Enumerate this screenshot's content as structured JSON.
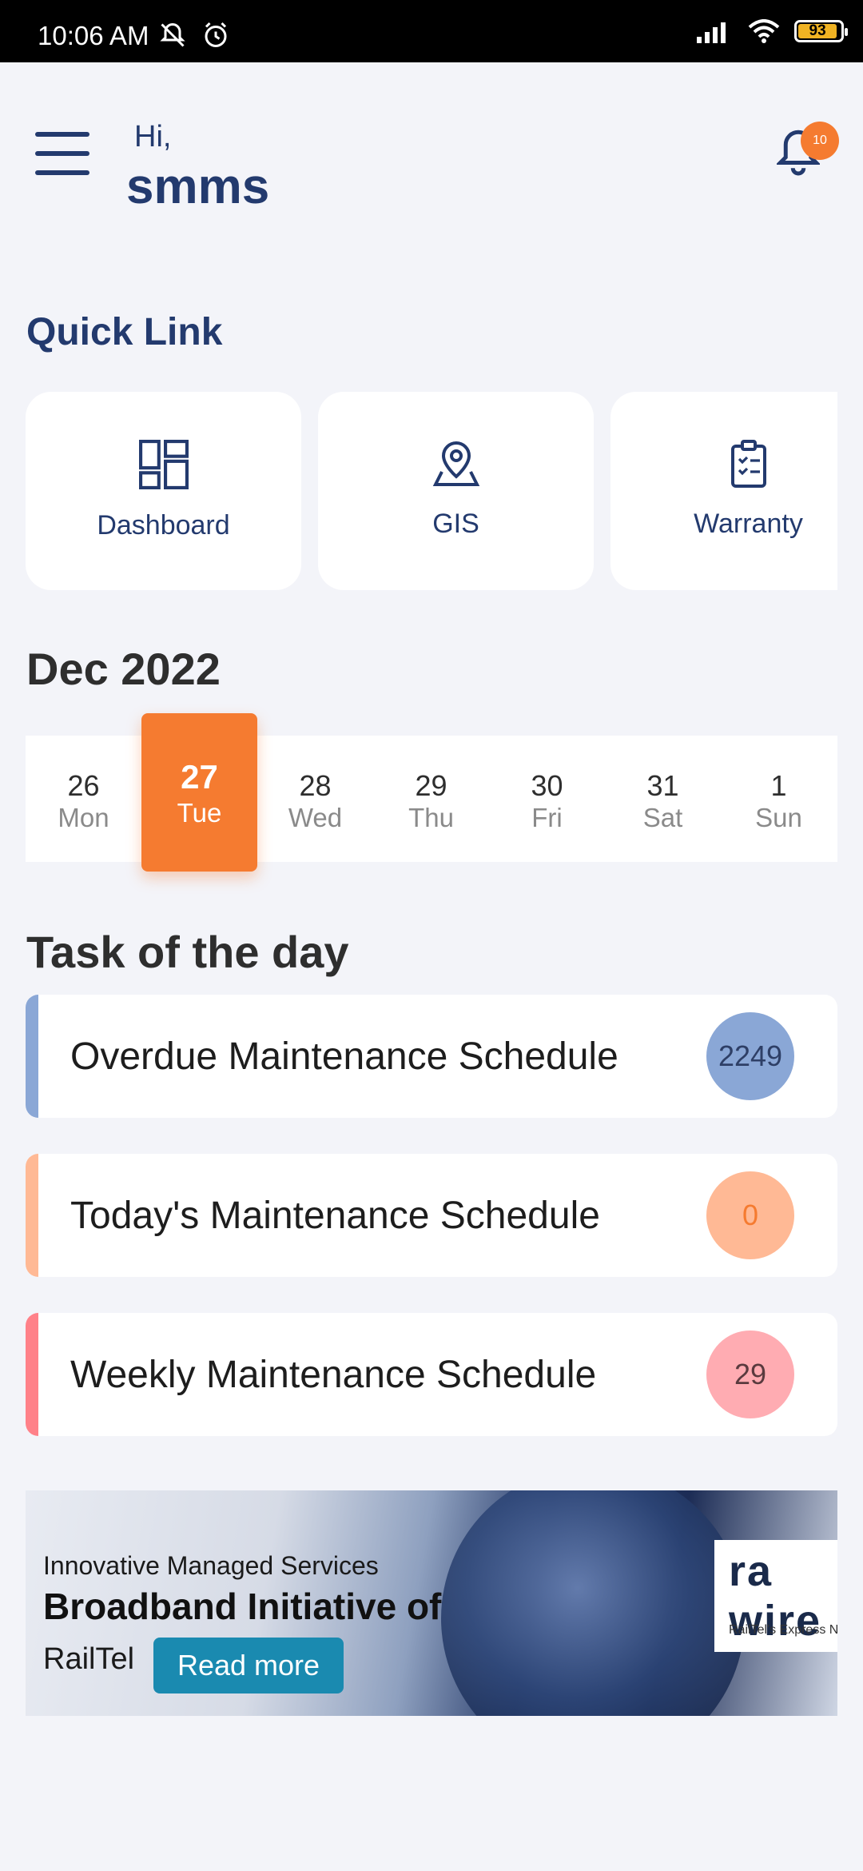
{
  "status_bar": {
    "time": "10:06 AM",
    "battery": "93"
  },
  "header": {
    "greeting": "Hi,",
    "username": "smms",
    "notification_count": "10"
  },
  "quick_link": {
    "title": "Quick Link",
    "items": [
      {
        "label": "Dashboard",
        "icon": "dashboard-icon"
      },
      {
        "label": "GIS",
        "icon": "location-pin-icon"
      },
      {
        "label": "Warranty",
        "icon": "clipboard-check-icon"
      }
    ]
  },
  "calendar": {
    "month": "Dec 2022",
    "days": [
      {
        "num": "26",
        "name": "Mon"
      },
      {
        "num": "27",
        "name": "Tue",
        "selected": true
      },
      {
        "num": "28",
        "name": "Wed"
      },
      {
        "num": "29",
        "name": "Thu"
      },
      {
        "num": "30",
        "name": "Fri"
      },
      {
        "num": "31",
        "name": "Sat"
      },
      {
        "num": "1",
        "name": "Sun"
      }
    ]
  },
  "tasks": {
    "title": "Task of the day",
    "items": [
      {
        "label": "Overdue Maintenance Schedule",
        "count": "2249",
        "accent": "#8aa7d6"
      },
      {
        "label": "Today's Maintenance Schedule",
        "count": "0",
        "accent": "#ffb995"
      },
      {
        "label": "Weekly Maintenance Schedule",
        "count": "29",
        "accent": "#ff9aa2"
      }
    ]
  },
  "banner": {
    "subtitle": "Innovative Managed Services",
    "title": "Broadband Initiative of",
    "brand": "RailTel",
    "button": "Read more",
    "logo_text": "ra wire",
    "logo_caption": "RailTel's Express NetwoR"
  }
}
